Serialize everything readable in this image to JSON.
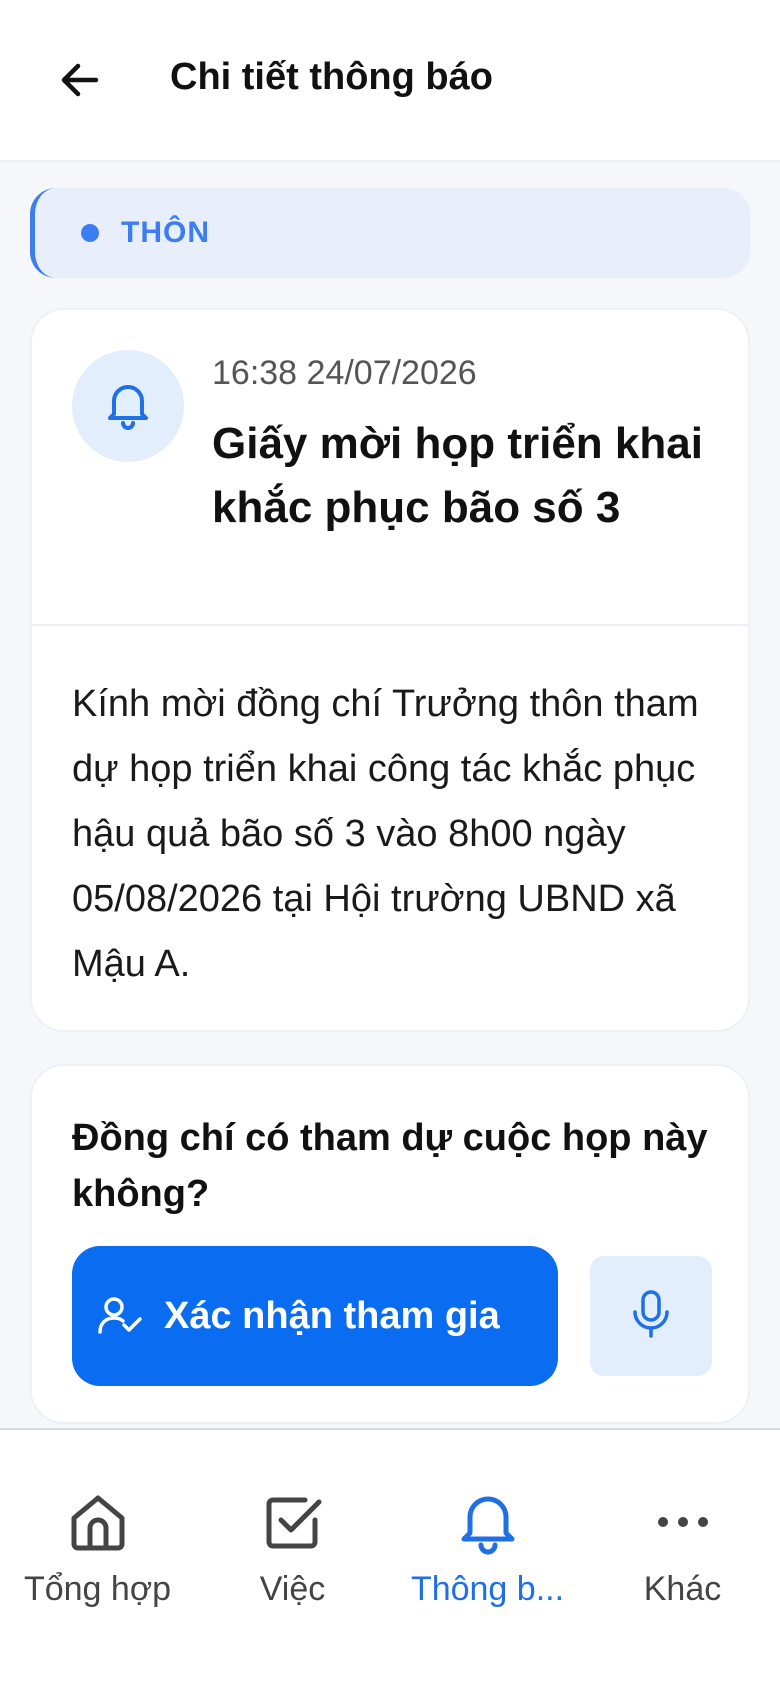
{
  "header": {
    "title": "Chi tiết thông báo",
    "back_icon": "arrow-left-icon"
  },
  "category": {
    "label": "THÔN",
    "color": "#3d7df0"
  },
  "notification": {
    "icon": "bell-icon",
    "time": "16:38 24/07/2026",
    "title": "Giấy mời họp triển khai khắc phục bão số 3",
    "body": "Kính mời đồng chí Trưởng thôn tham dự họp triển khai công tác khắc phục hậu quả bão số 3 vào 8h00 ngày 05/08/2026 tại Hội trường UBND xã Mậu A."
  },
  "rsvp": {
    "question": "Đồng chí có tham dự cuộc họp này không?",
    "confirm_label": "Xác nhận tham gia",
    "confirm_icon": "user-check-icon",
    "mic_icon": "microphone-icon",
    "accent": "#0a6cf0"
  },
  "bottom_nav": {
    "items": [
      {
        "label": "Tổng hợp",
        "icon": "home-icon",
        "active": false
      },
      {
        "label": "Việc",
        "icon": "checkbox-icon",
        "active": false
      },
      {
        "label": "Thông b...",
        "icon": "bell-icon",
        "active": true
      },
      {
        "label": "Khác",
        "icon": "more-icon",
        "active": false
      }
    ],
    "active_color": "#1f6fe5"
  }
}
